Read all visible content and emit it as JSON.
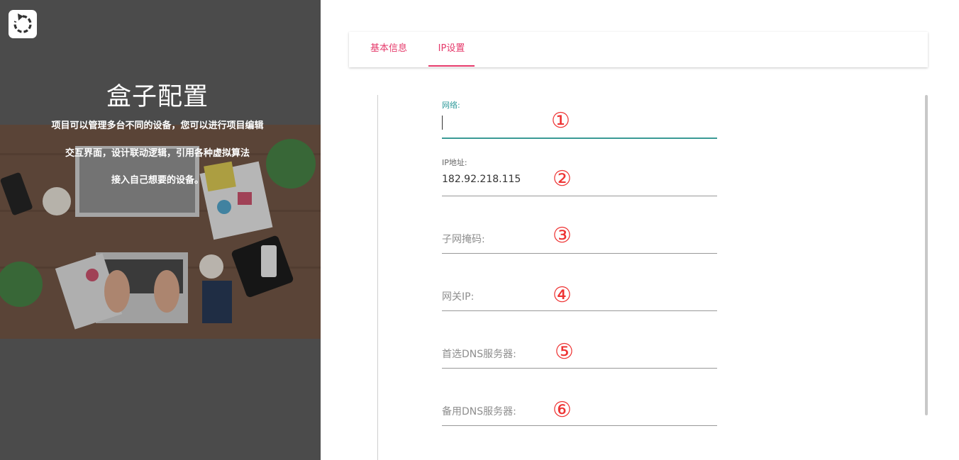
{
  "app": {
    "logo_icon": "refresh-circle-icon"
  },
  "panel": {
    "title": "盒子配置",
    "desc_lines": [
      "项目可以管理多台不同的设备，您可以进行项目编辑",
      "交互界面，设计联动逻辑，引用各种虚拟算法",
      "接入自己想要的设备。"
    ]
  },
  "tabs": [
    {
      "label": "基本信息",
      "active": false
    },
    {
      "label": "IP设置",
      "active": true
    }
  ],
  "form": {
    "fields": [
      {
        "label": "网络:",
        "value": "",
        "placeholder": "",
        "focused": true,
        "marker": "①"
      },
      {
        "label": "IP地址:",
        "value": "182.92.218.115",
        "placeholder": "",
        "focused": false,
        "marker": "②"
      },
      {
        "label": "",
        "value": "",
        "placeholder": "子网掩码:",
        "focused": false,
        "marker": "③"
      },
      {
        "label": "",
        "value": "",
        "placeholder": "网关IP:",
        "focused": false,
        "marker": "④"
      },
      {
        "label": "",
        "value": "",
        "placeholder": "首选DNS服务器:",
        "focused": false,
        "marker": "⑤"
      },
      {
        "label": "",
        "value": "",
        "placeholder": "备用DNS服务器:",
        "focused": false,
        "marker": "⑥"
      }
    ]
  },
  "colors": {
    "accent": "#e53a6b",
    "focus": "#3a9a96",
    "marker": "#ee3333",
    "panel_bg": "#4b4b4b"
  }
}
